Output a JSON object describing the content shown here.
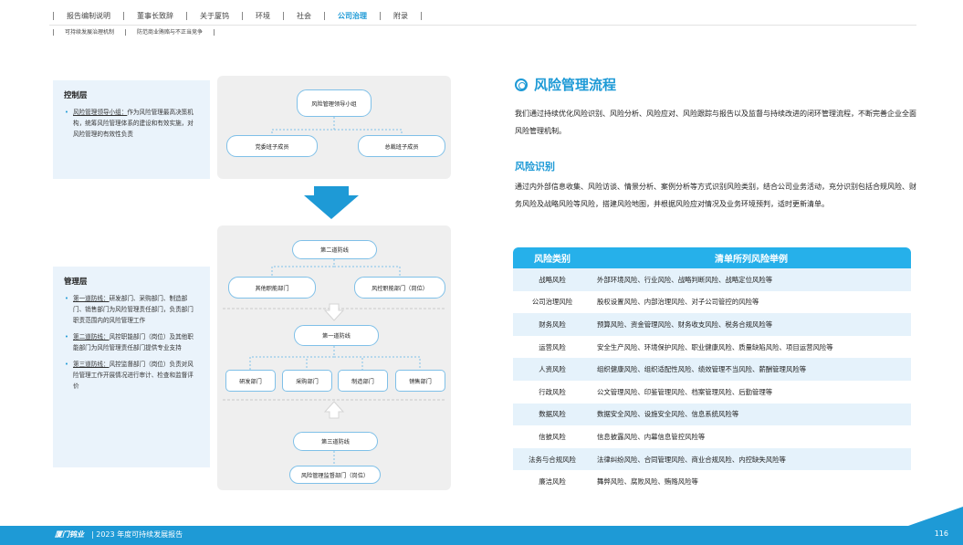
{
  "nav": {
    "items": [
      "报告编制说明",
      "董事长致辞",
      "关于厦钨",
      "环境",
      "社会",
      "公司治理",
      "附录"
    ],
    "active": 5
  },
  "subnav": {
    "items": [
      "可持续发展治理机制",
      "防范商业贿赂与不正当竞争"
    ]
  },
  "left": {
    "control": {
      "heading": "控制层",
      "bullet_link": "风险管理领导小组：",
      "bullet_text": "作为风险管理最高决策机构，统筹风险管理体系的建设和有效实施，对风险管理的有效性负责"
    },
    "manage": {
      "heading": "管理层",
      "b1_link": "第一道防线：",
      "b1_text": "研发部门、采购部门、制造部门、销售部门为风险管理责任部门，负责部门职责范围内的风险管理工作",
      "b2_link": "第二道防线：",
      "b2_text": "风控职能部门（岗位）及其他职能部门为风险管理责任部门提供专业支持",
      "b3_link": "第三道防线：",
      "b3_text": "风控监督部门（岗位）负责对风险管理工作开展情况进行审计、检查和监督评价"
    }
  },
  "diagram": {
    "top_node": "风险管理领导小组",
    "top_left": "党委班子成员",
    "top_right": "总裁班子成员",
    "second_line": "第二道防线",
    "second_left": "其他职能部门",
    "second_right": "风控职能部门（岗位）",
    "first_line": "第一道防线",
    "first_children": [
      "研发部门",
      "采购部门",
      "制造部门",
      "销售部门"
    ],
    "third_line": "第三道防线",
    "third_child": "风险管理监督部门（岗位）"
  },
  "right": {
    "title": "风险管理流程",
    "intro": "我们通过持续优化风险识别、风险分析、风险应对、风险跟踪与报告以及监督与持续改进的闭环管理流程，不断完善企业全面风险管理机制。",
    "subhead": "风险识别",
    "body": "通过内外部信息收集、风险访谈、情景分析、案例分析等方式识别风险类别，结合公司业务活动，充分识别包括合规风险、财务风险及战略风险等风险，搭建风险地图，并根据风险应对情况及业务环境预判，适时更新清单。"
  },
  "table": {
    "headers": [
      "风险类别",
      "清单所列风险举例"
    ],
    "rows": [
      [
        "战略风险",
        "外部环境风险、行业风险、战略判断风险、战略定位风险等"
      ],
      [
        "公司治理风险",
        "股权设置风险、内部治理风险、对子公司管控的风险等"
      ],
      [
        "财务风险",
        "预算风险、资金管理风险、财务收支风险、税务合规风险等"
      ],
      [
        "运营风险",
        "安全生产风险、环境保护风险、职业健康风险、质量缺陷风险、项目运营风险等"
      ],
      [
        "人资风险",
        "组织健康风险、组织适配性风险、绩效管理不当风险、薪酬管理风险等"
      ],
      [
        "行政风险",
        "公文管理风险、印鉴管理风险、档案管理风险、后勤管理等"
      ],
      [
        "数据风险",
        "数据安全风险、设施安全风险、信息系统风险等"
      ],
      [
        "信披风险",
        "信息披露风险、内幕信息管控风险等"
      ],
      [
        "法务与合规风险",
        "法律纠纷风险、合同管理风险、商业合规风险、内控缺失风险等"
      ],
      [
        "廉洁风险",
        "舞弊风险、腐败风险、贿赂风险等"
      ]
    ]
  },
  "footer": {
    "logo": "厦门钨业",
    "text": "|  2023 年度可持续发展报告",
    "page": "116"
  },
  "colors": {
    "accent": "#1e9ad6",
    "table_header": "#26b0ea",
    "row_alt": "#e5f2fb",
    "panel": "#efefef"
  }
}
